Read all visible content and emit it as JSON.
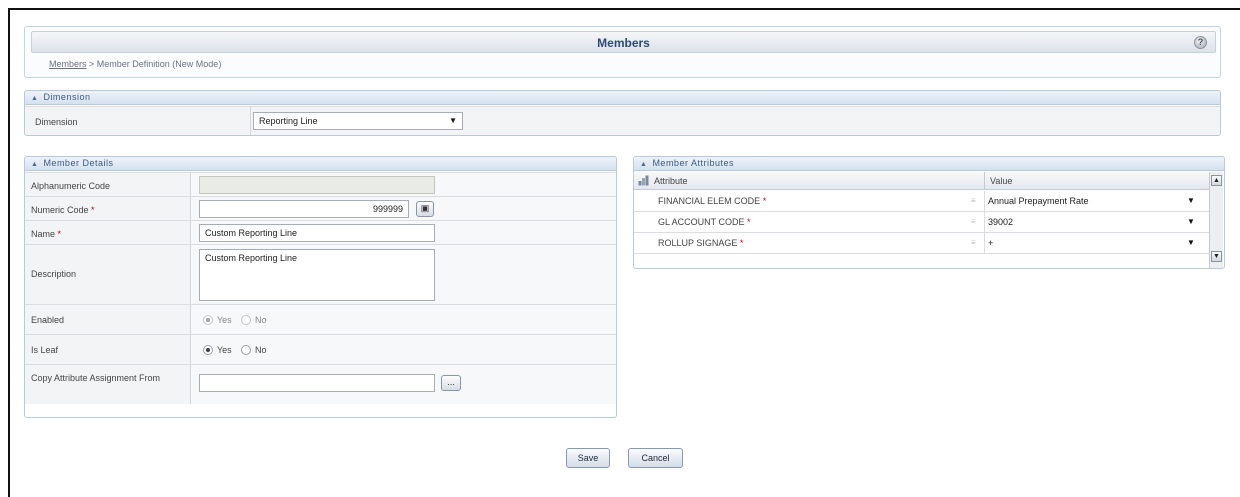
{
  "header": {
    "title": "Members",
    "help_icon": "help-icon",
    "breadcrumb_link": "Members",
    "breadcrumb_rest": " > Member Definition (New Mode)"
  },
  "dimension_section": {
    "title": "Dimension",
    "label": "Dimension",
    "selected": "Reporting Line"
  },
  "details_section": {
    "title": "Member Details",
    "alphanumeric_code": {
      "label": "Alphanumeric Code",
      "value": ""
    },
    "numeric_code": {
      "label": "Numeric Code",
      "required": "*",
      "value": "999999"
    },
    "name": {
      "label": "Name",
      "required": "*",
      "value": "Custom Reporting Line"
    },
    "description": {
      "label": "Description",
      "value": "Custom Reporting Line"
    },
    "enabled": {
      "label": "Enabled",
      "yes": "Yes",
      "no": "No",
      "selected": "Yes"
    },
    "is_leaf": {
      "label": "Is Leaf",
      "yes": "Yes",
      "no": "No",
      "selected": "Yes"
    },
    "copy_attr": {
      "label": "Copy Attribute Assignment From",
      "value": "",
      "browse_label": "..."
    }
  },
  "attributes_section": {
    "title": "Member Attributes",
    "columns": [
      "Attribute",
      "Value"
    ],
    "rows": [
      {
        "name": "FINANCIAL ELEM CODE",
        "required": "*",
        "value": "Annual Prepayment Rate"
      },
      {
        "name": "GL ACCOUNT CODE",
        "required": "*",
        "value": "39002"
      },
      {
        "name": "ROLLUP SIGNAGE",
        "required": "*",
        "value": "+"
      }
    ]
  },
  "actions": {
    "save_label": "Save",
    "cancel_label": "Cancel"
  }
}
